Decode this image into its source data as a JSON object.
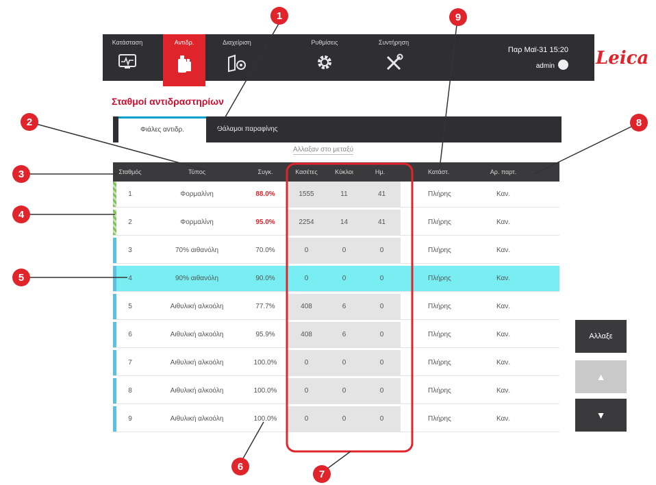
{
  "nav": {
    "tabs": [
      {
        "label": "Κατάσταση",
        "icon": "status-screen-icon"
      },
      {
        "label": "Αντιδρ.",
        "icon": "reagent-bottle-icon",
        "active": true
      },
      {
        "label": "Διαχείριση",
        "icon": "administration-icon"
      },
      {
        "label": "Ρυθμίσεις",
        "icon": "settings-gear-icon"
      },
      {
        "label": "Συντήρηση",
        "icon": "maintenance-tools-icon"
      }
    ],
    "datetime": "Παρ Μαϊ-31 15:20",
    "user": "admin",
    "logo": "Leica"
  },
  "page": {
    "title": "Σταθμοί αντιδραστηρίων",
    "tabs": [
      "Φιάλες αντιδρ.",
      "Θάλαμοι παραφίνης"
    ],
    "hint": "Αλλαξαν στο μεταξύ"
  },
  "table": {
    "headers": [
      "Σταθμός",
      "Τύπος",
      "Συγκ.",
      "Κασέτες",
      "Κύκλοι",
      "Ημ.",
      "Κατάστ.",
      "Αρ. παρτ."
    ],
    "rows": [
      {
        "station": "1",
        "type": "Φορμαλίνη",
        "conc": "88.0%",
        "cassettes": "1555",
        "cycles": "11",
        "days": "41",
        "status": "Πλήρης",
        "lot": "Καν.",
        "conc_warn": true,
        "bar": "full"
      },
      {
        "station": "2",
        "type": "Φορμαλίνη",
        "conc": "95.0%",
        "cassettes": "2254",
        "cycles": "14",
        "days": "41",
        "status": "Πλήρης",
        "lot": "Καν.",
        "conc_warn": true,
        "bar": "full"
      },
      {
        "station": "3",
        "type": "70% αιθανόλη",
        "conc": "70.0%",
        "cassettes": "0",
        "cycles": "0",
        "days": "0",
        "status": "Πλήρης",
        "lot": "Καν."
      },
      {
        "station": "4",
        "type": "90% αιθανόλη",
        "conc": "90.0%",
        "cassettes": "0",
        "cycles": "0",
        "days": "0",
        "status": "Πλήρης",
        "lot": "Καν.",
        "selected": true
      },
      {
        "station": "5",
        "type": "Αιθυλική αλκοόλη",
        "conc": "77.7%",
        "cassettes": "408",
        "cycles": "6",
        "days": "0",
        "status": "Πλήρης",
        "lot": "Καν."
      },
      {
        "station": "6",
        "type": "Αιθυλική αλκοόλη",
        "conc": "95.9%",
        "cassettes": "408",
        "cycles": "6",
        "days": "0",
        "status": "Πλήρης",
        "lot": "Καν."
      },
      {
        "station": "7",
        "type": "Αιθυλική αλκοόλη",
        "conc": "100.0%",
        "cassettes": "0",
        "cycles": "0",
        "days": "0",
        "status": "Πλήρης",
        "lot": "Καν."
      },
      {
        "station": "8",
        "type": "Αιθυλική αλκοόλη",
        "conc": "100.0%",
        "cassettes": "0",
        "cycles": "0",
        "days": "0",
        "status": "Πλήρης",
        "lot": "Καν."
      },
      {
        "station": "9",
        "type": "Αιθυλική αλκοόλη",
        "conc": "100.0%",
        "cassettes": "0",
        "cycles": "0",
        "days": "0",
        "status": "Πλήρης",
        "lot": "Καν."
      }
    ]
  },
  "buttons": {
    "change": "Αλλαξε",
    "up": "▲",
    "down": "▼"
  },
  "callouts": [
    "1",
    "2",
    "3",
    "4",
    "5",
    "6",
    "7",
    "8",
    "9"
  ],
  "colors": {
    "accent_red": "#e0242c",
    "dark_bar": "#2f2f33",
    "selected_row": "#78eef2",
    "station_bar": "#5bc1e2"
  }
}
